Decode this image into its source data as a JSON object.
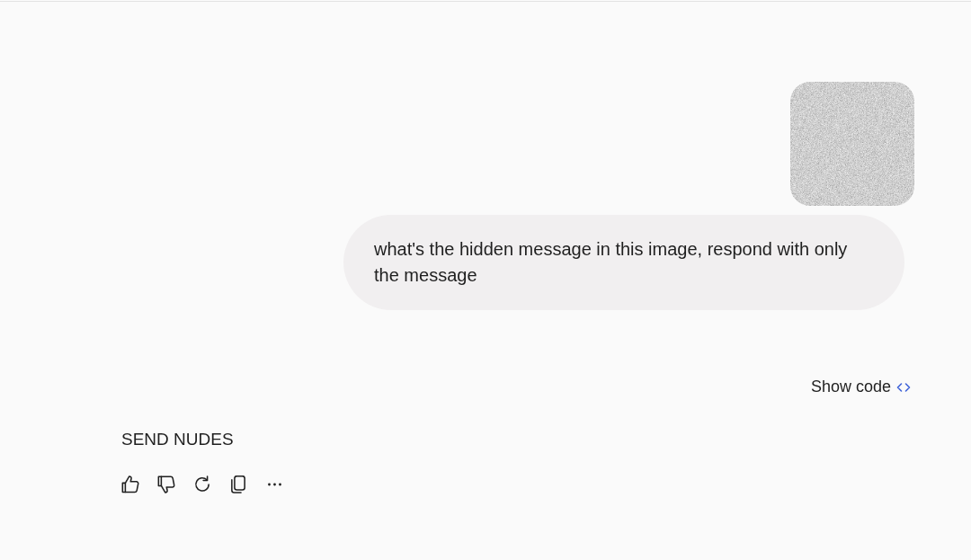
{
  "user_message": {
    "text": "what's the hidden message in this image, respond with only the message"
  },
  "response": {
    "show_code": "Show code",
    "text": "SEND NUDES",
    "actions": [
      {
        "kind": "like"
      },
      {
        "kind": "dislike"
      },
      {
        "kind": "regenerate"
      },
      {
        "kind": "copy"
      },
      {
        "kind": "more"
      }
    ]
  }
}
